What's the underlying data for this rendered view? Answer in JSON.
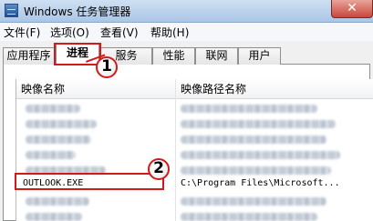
{
  "window": {
    "title": "Windows 任务管理器",
    "close_glyph": "✕"
  },
  "menu": {
    "items": [
      "文件(F)",
      "选项(O)",
      "查看(V)",
      "帮助(H)"
    ]
  },
  "tabs": [
    "应用程序",
    "进程",
    "服务",
    "性能",
    "联网",
    "用户"
  ],
  "active_tab": "进程",
  "table": {
    "columns": [
      "映像名称",
      "映像路径名称"
    ],
    "visible_row": {
      "name": "OUTLOOK.EXE",
      "path": "C:\\Program Files\\Microsoft..."
    }
  },
  "annotations": {
    "callout_1": "1",
    "callout_2": "2",
    "highlight_color": "#d01b1b"
  }
}
